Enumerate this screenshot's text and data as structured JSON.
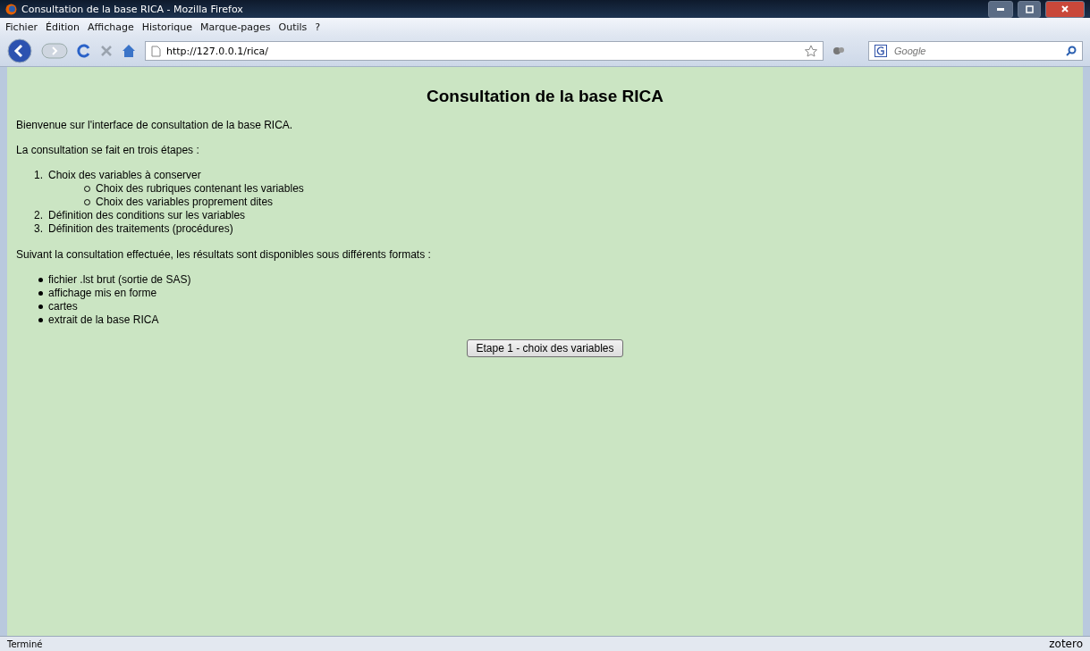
{
  "window": {
    "title": "Consultation de la base RICA - Mozilla Firefox"
  },
  "menu": [
    "Fichier",
    "Édition",
    "Affichage",
    "Historique",
    "Marque-pages",
    "Outils",
    "?"
  ],
  "address": {
    "value": "http://127.0.0.1/rica/"
  },
  "search": {
    "placeholder": "Google"
  },
  "page": {
    "heading": "Consultation de la base RICA",
    "intro": "Bienvenue sur l'interface de consultation de la base RICA.",
    "steps_intro": "La consultation se fait en trois étapes :",
    "steps": [
      {
        "number": "1.",
        "text": "Choix des variables à conserver",
        "children": [
          {
            "text": "Choix des rubriques contenant les variables"
          },
          {
            "text": "Choix des variables proprement dites"
          }
        ]
      },
      {
        "number": "2.",
        "text": "Définition des conditions sur les variables"
      },
      {
        "number": "3.",
        "text": "Définition des traitements (procédures)"
      }
    ],
    "formats_intro": "Suivant la consultation effectuée, les résultats sont disponibles sous différents formats :",
    "formats": [
      "fichier .lst brut (sortie de SAS)",
      "affichage mis en forme",
      "cartes",
      "extrait de la base RICA"
    ],
    "button": "Etape 1 - choix des variables"
  },
  "status_bar": {
    "text": "Terminé",
    "addon": "zotero"
  }
}
